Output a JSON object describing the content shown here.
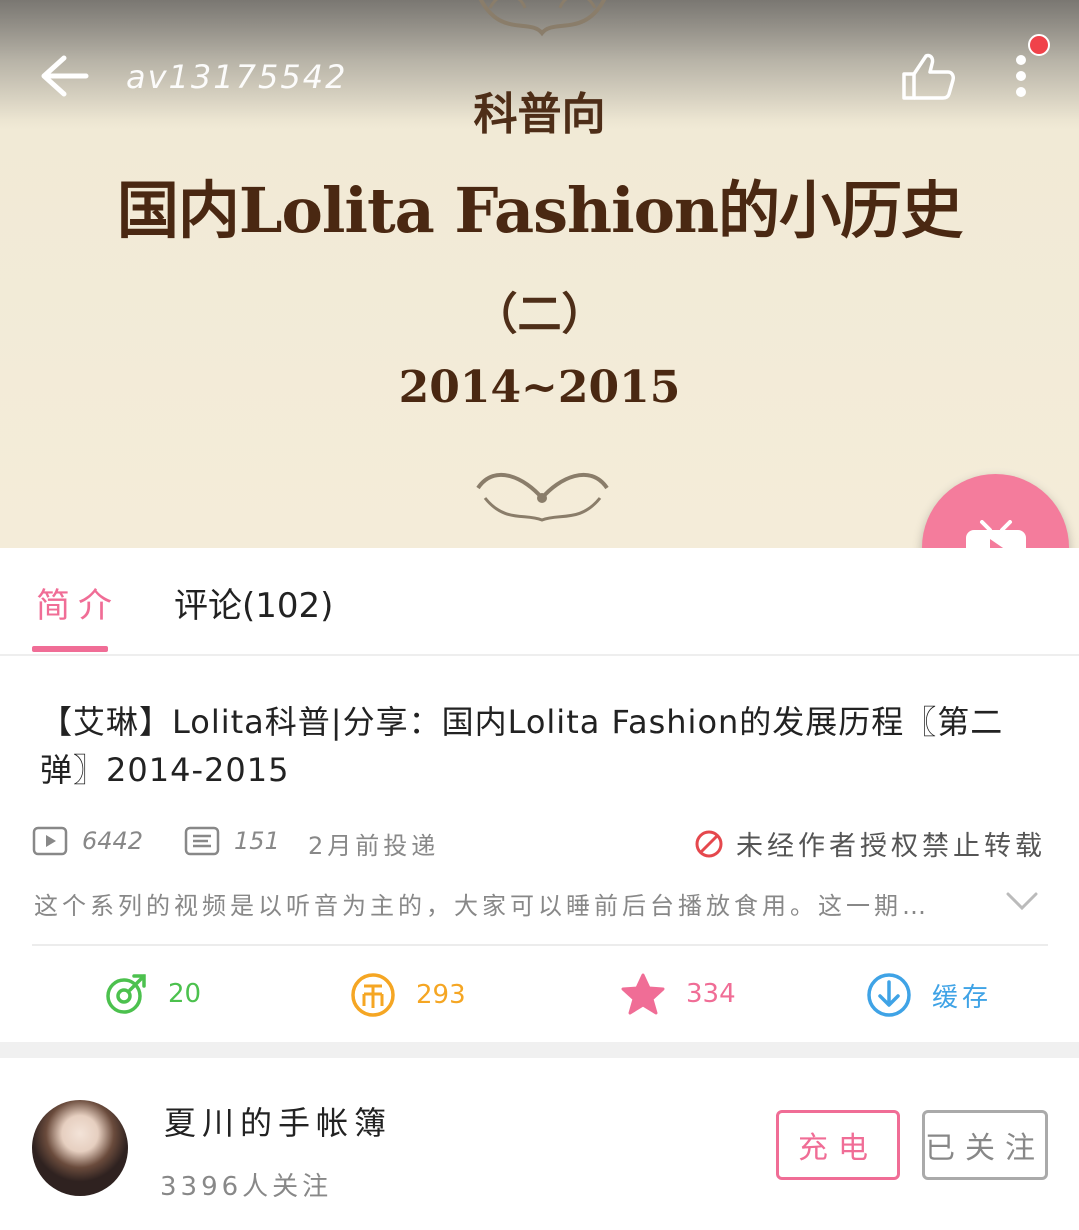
{
  "header": {
    "video_id": "av13175542"
  },
  "cover": {
    "kicker": "科普向",
    "title": "国内Lolita Fashion的小历史",
    "part": "（二）",
    "years": "2014~2015"
  },
  "tabs": [
    {
      "label": "简介",
      "active": true
    },
    {
      "label": "评论(102)",
      "active": false
    }
  ],
  "video": {
    "title": "【艾琳】Lolita科普|分享：国内Lolita Fashion的发展历程〖第二弹〗2014-2015",
    "plays": "6442",
    "danmaku": "151",
    "posted": "2月前投递",
    "repost_notice": "未经作者授权禁止转载",
    "description": "这个系列的视频是以听音为主的，大家可以睡前后台播放食用。这一期…"
  },
  "actions": {
    "share_count": "20",
    "coin_count": "293",
    "favorite_count": "334",
    "cache_label": "缓存"
  },
  "uploader": {
    "name": "夏川的手帐簿",
    "followers": "3396人关注",
    "charge_label": "充电",
    "follow_label": "已关注"
  },
  "colors": {
    "accent_pink": "#f06d96",
    "fab_pink": "#f47c9c",
    "share_green": "#4cc14e",
    "coin_orange": "#f5a623",
    "star_pink": "#f06d96",
    "cache_blue": "#3fa3e6",
    "notice_red": "#e5484d"
  },
  "icons": [
    "back-arrow-icon",
    "thumbs-up-icon",
    "more-vertical-icon",
    "tv-play-icon",
    "play-count-icon",
    "danmaku-icon",
    "no-entry-icon",
    "chevron-down-icon",
    "share-icon",
    "coin-icon",
    "star-icon",
    "download-icon"
  ]
}
